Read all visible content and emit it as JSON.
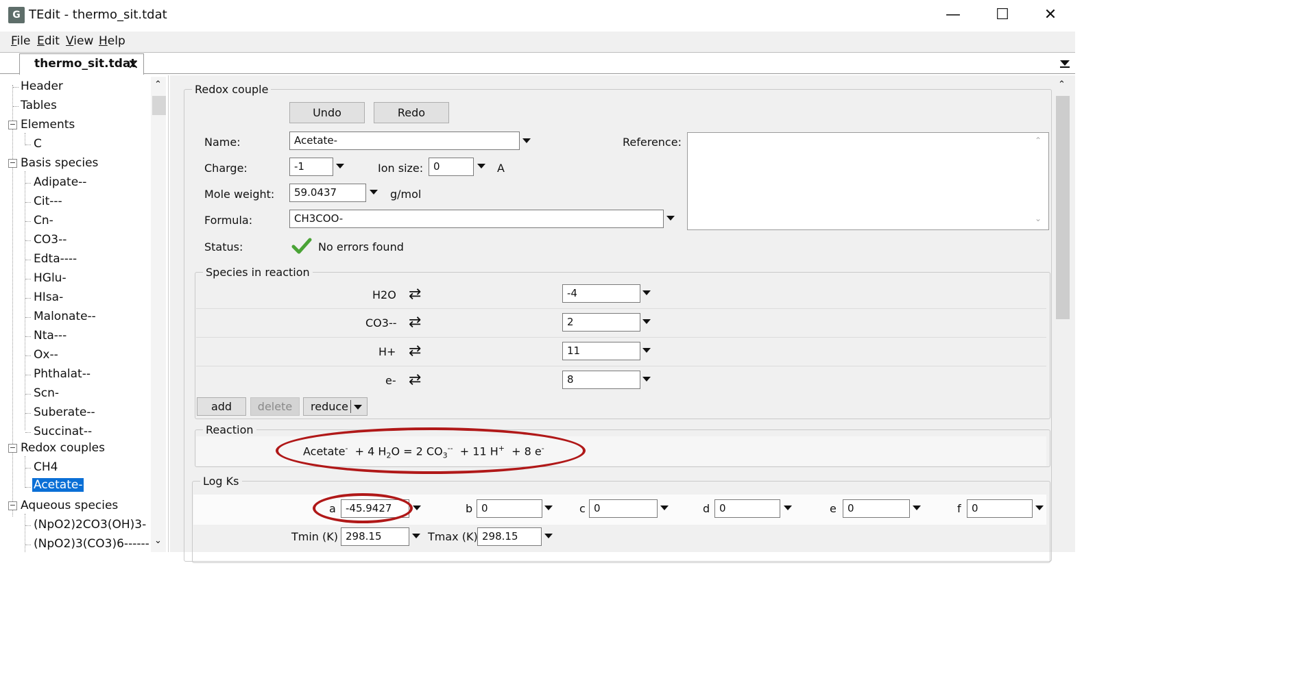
{
  "window": {
    "title": "TEdit - thermo_sit.tdat",
    "minimize": "—",
    "maximize": "☐",
    "close": "✕"
  },
  "menu": [
    "File",
    "Edit",
    "View",
    "Help"
  ],
  "tab": {
    "label": "thermo_sit.tdat",
    "close": "✕"
  },
  "tree": {
    "header": "Header",
    "tables": "Tables",
    "elements": "Elements",
    "elements_children": [
      "C"
    ],
    "basis": "Basis species",
    "basis_children": [
      "Adipate--",
      "Cit---",
      "Cn-",
      "CO3--",
      "Edta----",
      "HGlu-",
      "HIsa-",
      "Malonate--",
      "Nta---",
      "Ox--",
      "Phthalat--",
      "Scn-",
      "Suberate--",
      "Succinat--"
    ],
    "redox": "Redox couples",
    "redox_children": [
      "CH4",
      "Acetate-"
    ],
    "aqueous": "Aqueous species",
    "aqueous_children": [
      "(NpO2)2CO3(OH)3-",
      "(NpO2)3(CO3)6------"
    ]
  },
  "redox_couple": {
    "group_title": "Redox couple",
    "undo": "Undo",
    "redo": "Redo",
    "name_label": "Name:",
    "name_value": "Acetate-",
    "reference_label": "Reference:",
    "charge_label": "Charge:",
    "charge_value": "-1",
    "ion_size_label": "Ion size:",
    "ion_size_value": "0",
    "ion_size_unit": "A",
    "mole_weight_label": "Mole weight:",
    "mole_weight_value": "59.0437",
    "mole_weight_unit": "g/mol",
    "formula_label": "Formula:",
    "formula_value": "CH3COO-",
    "status_label": "Status:",
    "status_text": "No errors found"
  },
  "species_in_reaction": {
    "group_title": "Species in reaction",
    "rows": [
      {
        "species": "H2O",
        "coeff": "-4"
      },
      {
        "species": "CO3--",
        "coeff": "2"
      },
      {
        "species": "H+",
        "coeff": "11"
      },
      {
        "species": "e-",
        "coeff": "8"
      }
    ],
    "add": "add",
    "delete": "delete",
    "reduce": "reduce"
  },
  "reaction": {
    "group_title": "Reaction",
    "p1": "Acetate",
    "p1_sup": "-",
    "p2": "+  4 H",
    "p2_sub": "2",
    "p3": "O  =  2 CO",
    "p3_sub": "3",
    "p3_sup": "--",
    "p4": "+  11 H",
    "p4_sup": "+",
    "p5": "+  8 e",
    "p5_sup": "-"
  },
  "log_ks": {
    "group_title": "Log Ks",
    "a_label": "a",
    "a_value": "-45.9427",
    "b_label": "b",
    "b_value": "0",
    "c_label": "c",
    "c_value": "0",
    "d_label": "d",
    "d_value": "0",
    "e_label": "e",
    "e_value": "0",
    "f_label": "f",
    "f_value": "0",
    "tmin_label": "Tmin (K)",
    "tmin_value": "298.15",
    "tmax_label": "Tmax (K)",
    "tmax_value": "298.15"
  },
  "colors": {
    "highlight_ellipse": "#b01818",
    "selection": "#0a6fd6",
    "check": "#4aa336"
  }
}
